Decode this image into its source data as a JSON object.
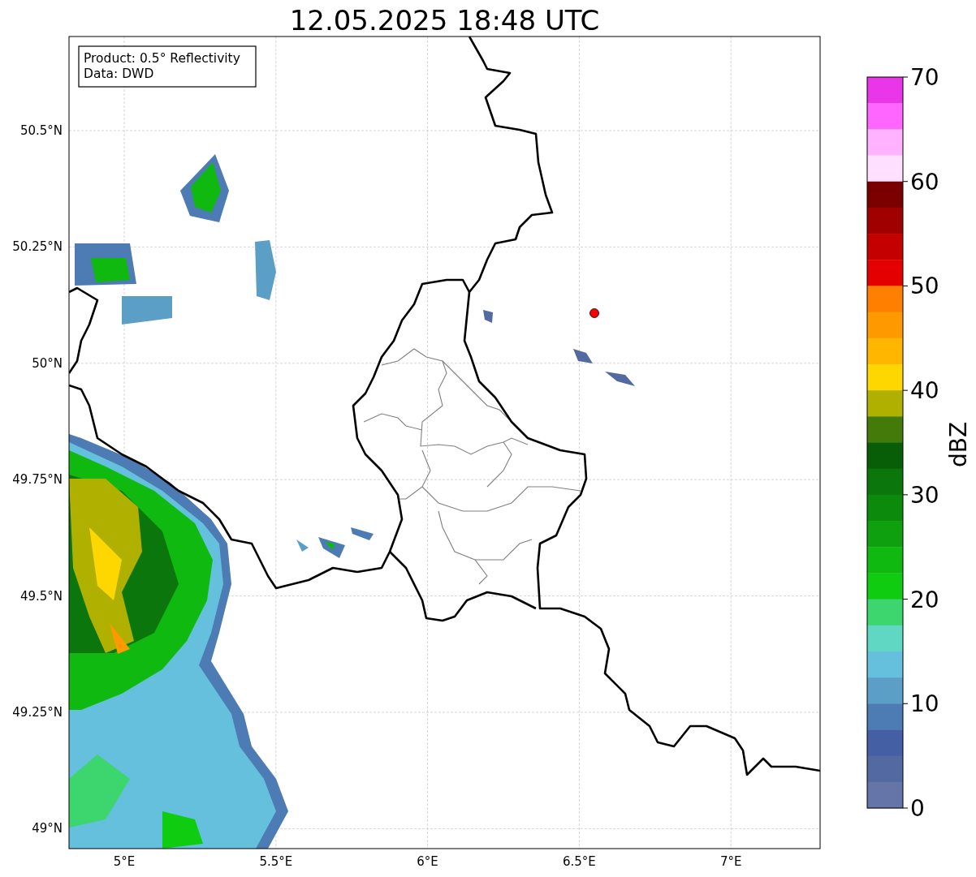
{
  "title": "12.05.2025 18:48 UTC",
  "map": {
    "info_lines": [
      "Product: 0.5° Reflectivity",
      "Data: DWD"
    ],
    "lat_ticks": [
      "50.5°N",
      "50.25°N",
      "50°N",
      "49.75°N",
      "49.5°N",
      "49.25°N",
      "49°N"
    ],
    "lon_ticks": [
      "5°E",
      "5.5°E",
      "6°E",
      "6.5°E",
      "7°E"
    ]
  },
  "colorbar": {
    "label": "dBZ",
    "ticks": [
      "70",
      "60",
      "50",
      "40",
      "30",
      "20",
      "10",
      "0"
    ],
    "colors": [
      {
        "color": "#e936e9"
      },
      {
        "color": "#ff66ff"
      },
      {
        "color": "#ffb3ff"
      },
      {
        "color": "#ffe0ff"
      },
      {
        "color": "#7a0000"
      },
      {
        "color": "#a00000"
      },
      {
        "color": "#c40000"
      },
      {
        "color": "#e40000"
      },
      {
        "color": "#ff7f00"
      },
      {
        "color": "#ff9900"
      },
      {
        "color": "#ffb600"
      },
      {
        "color": "#ffd700"
      },
      {
        "color": "#afb000"
      },
      {
        "color": "#437a0a"
      },
      {
        "color": "#075e07"
      },
      {
        "color": "#0b760b"
      },
      {
        "color": "#0c8a0c"
      },
      {
        "color": "#0ea00e"
      },
      {
        "color": "#10b910"
      },
      {
        "color": "#10cc10"
      },
      {
        "color": "#3dd56d"
      },
      {
        "color": "#60d7c3"
      },
      {
        "color": "#65c0dd"
      },
      {
        "color": "#5b9fc7"
      },
      {
        "color": "#4d7bb3"
      },
      {
        "color": "#455fa4"
      },
      {
        "color": "#536aa0"
      },
      {
        "color": "#6675a8"
      }
    ]
  }
}
